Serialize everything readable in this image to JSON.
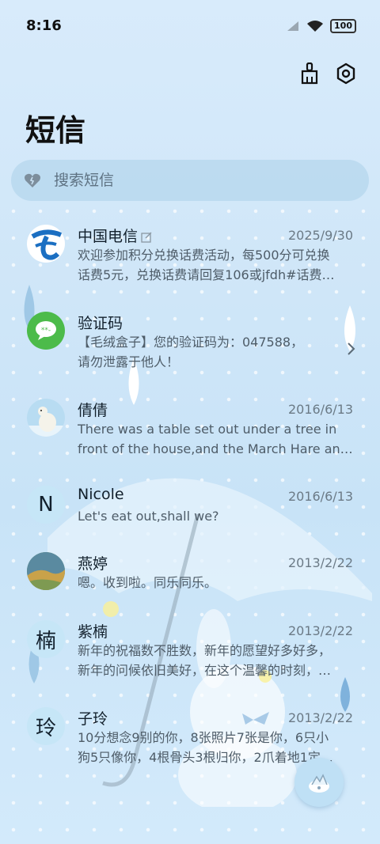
{
  "status_bar": {
    "time": "8:16",
    "battery": "100"
  },
  "header": {
    "title": "短信"
  },
  "search": {
    "placeholder": "搜索短信"
  },
  "conversations": [
    {
      "name": "中国电信",
      "date": "2025/9/30",
      "line1": "欢迎参加积分兑换话费活动，每500分可兑换",
      "line2": "话费5元，兑换话费请回复106或jfdh#话费…"
    },
    {
      "name": "验证码",
      "date": "",
      "line1": "【毛绒盒子】您的验证码为：047588，",
      "line2": "请勿泄露于他人！"
    },
    {
      "name": "倩倩",
      "date": "2016/6/13",
      "line1": "There was a table set out under a tree in",
      "line2": "front of the house,and the March Hare an…"
    },
    {
      "name": "Nicole",
      "date": "2016/6/13",
      "avatar_letter": "N",
      "line1": "Let's eat out,shall we?",
      "line2": ""
    },
    {
      "name": "燕婷",
      "date": "2013/2/22",
      "line1": "嗯。收到啦。同乐同乐。",
      "line2": ""
    },
    {
      "name": "紫楠",
      "date": "2013/2/22",
      "avatar_letter": "楠",
      "line1": "新年的祝福数不胜数，新年的愿望好多好多，",
      "line2": "新年的问候依旧美好，在这个温馨的时刻，…"
    },
    {
      "name": "子玲",
      "date": "2013/2/22",
      "avatar_letter": "玲",
      "line1": "10分想念9别的你，8张照片7张是你，6只小",
      "line2": "狗5只像你，4根骨头3根归你，2爪着地1定…"
    }
  ],
  "colors": {
    "telecom_blue": "#1b6fc2",
    "sms_green": "#4cbb4a",
    "accent_light": "#c6e6f7"
  }
}
